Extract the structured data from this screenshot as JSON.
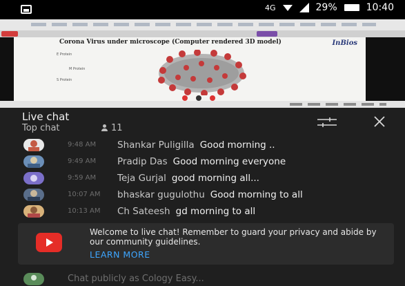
{
  "status_bar": {
    "network": "4G",
    "battery": "29%",
    "time": "10:40"
  },
  "video": {
    "slide_title": "Corona Virus under microscope (Computer rendered 3D model)",
    "slide_logo": "InBios",
    "labels": [
      "E Protein",
      "M Protein",
      "S Protein"
    ]
  },
  "chat": {
    "title": "Live chat",
    "mode": "Top chat",
    "viewers": "11",
    "messages": [
      {
        "time": "9:48 AM",
        "author": "Shankar Puligilla",
        "text": "Good morning .."
      },
      {
        "time": "9:49 AM",
        "author": "Pradip Das",
        "text": "Good morning everyone"
      },
      {
        "time": "9:59 AM",
        "author": "Teja Gurjal",
        "text": "good morning all..."
      },
      {
        "time": "10:07 AM",
        "author": "bhaskar gugulothu",
        "text": "Good morning to all"
      },
      {
        "time": "10:13 AM",
        "author": "Ch Sateesh",
        "text": "gd morning to all"
      }
    ],
    "notice": {
      "text": "Welcome to live chat! Remember to guard your privacy and abide by our community guidelines.",
      "link": "LEARN MORE"
    },
    "input_placeholder": "Chat publicly as Cology Easy..."
  },
  "colors": {
    "background": "#1f1f1f",
    "link": "#3ea6ff",
    "youtube_red": "#e52d27"
  }
}
